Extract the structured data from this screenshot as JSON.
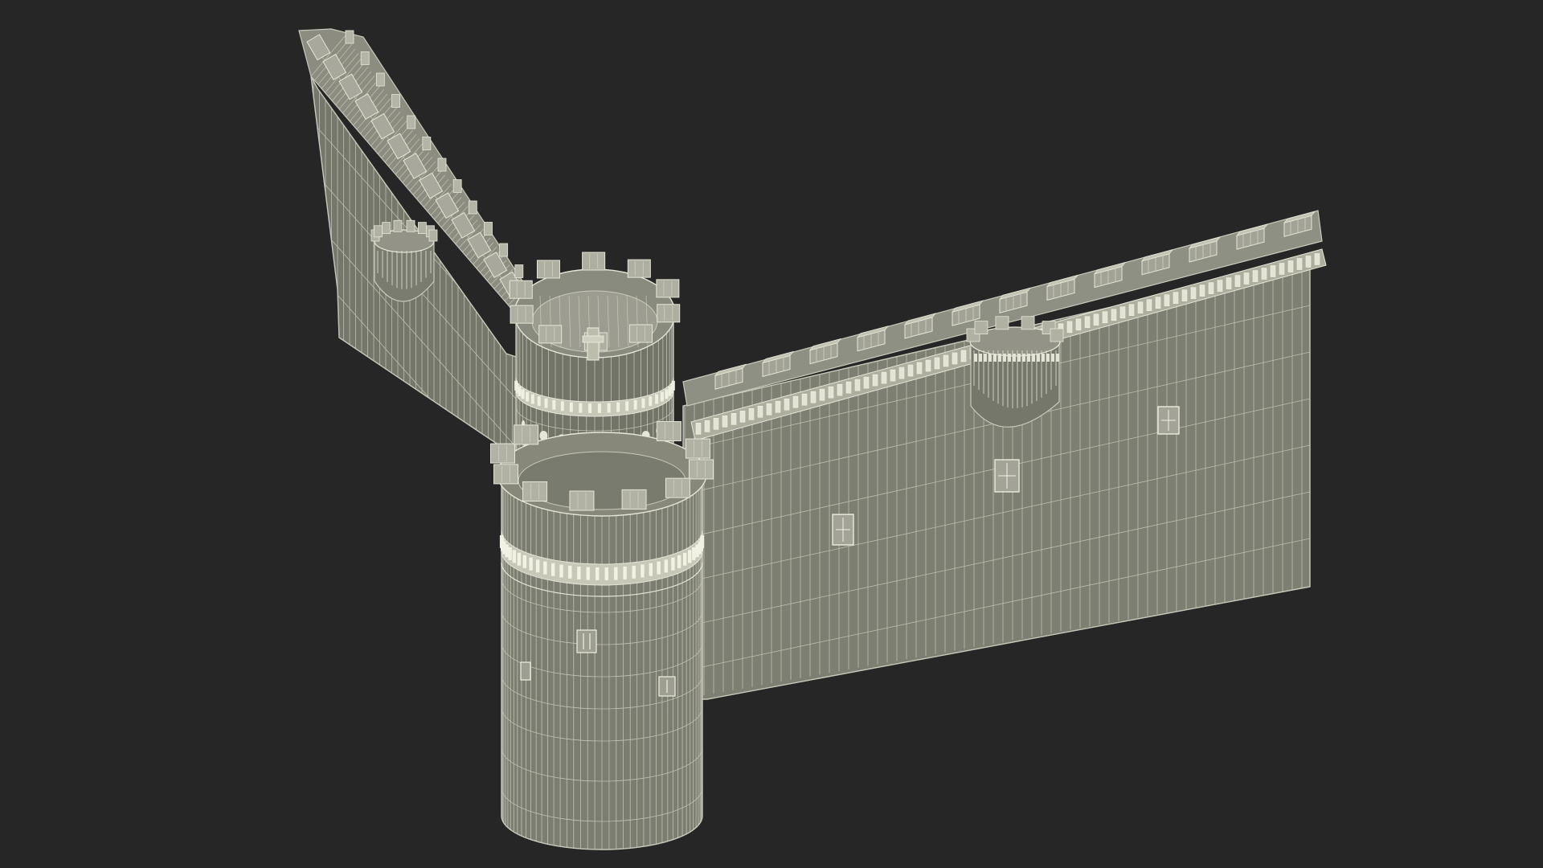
{
  "scene": {
    "subject": "castle-wall-corner-wireframe",
    "colors": {
      "background": "#262626",
      "wall_fill": "#7d7f72",
      "wall_fill_dark": "#6f7166",
      "wall_fill_shade": "#64665c",
      "wire": "#c9c9bb",
      "wire_bright": "#e6e6d8",
      "top_fill": "#9a9b8e"
    },
    "components": {
      "left_wall": "left-wall",
      "right_wall": "right-wall",
      "corner_tower": "corner-tower",
      "upper_turret": "upper-turret",
      "right_bartizan": "right-bartizan",
      "left_bartizan": "left-bartizan",
      "windows": 6
    }
  }
}
